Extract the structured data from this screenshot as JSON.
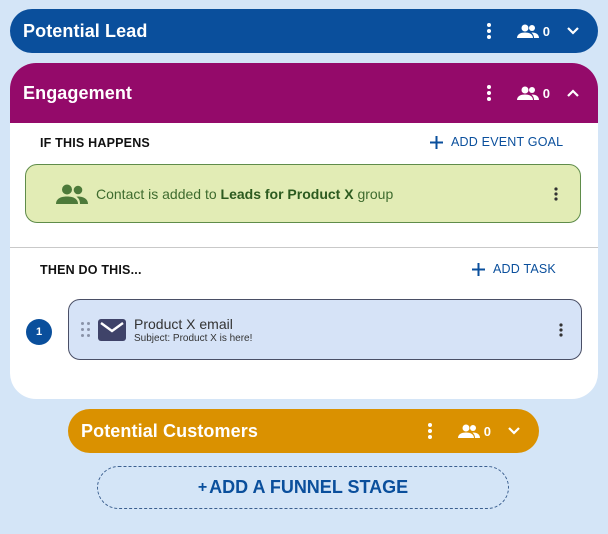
{
  "colors": {
    "potential_lead": "#0a4f9c",
    "engagement": "#940a6a",
    "potential_customers": "#da9100",
    "event_card_bg": "#e2ecb5",
    "task_card_bg": "#d6e3f7",
    "page_bg": "#d4e5f7"
  },
  "stages": [
    {
      "title": "Potential Lead",
      "count": "0",
      "icons": [
        "more-vert-icon",
        "people-icon",
        "chevron-down-icon"
      ]
    },
    {
      "title": "Engagement",
      "count": "0",
      "icons": [
        "more-vert-icon",
        "people-icon",
        "chevron-up-icon"
      ]
    },
    {
      "title": "Potential Customers",
      "count": "0",
      "icons": [
        "more-vert-icon",
        "people-icon",
        "chevron-down-icon"
      ]
    }
  ],
  "engagement": {
    "if_label": "IF THIS HAPPENS",
    "add_event_goal": "ADD EVENT GOAL",
    "event": {
      "icon": "group-icon",
      "prefix": "Contact is added to ",
      "group_name": "Leads for Product X",
      "suffix": " group"
    },
    "then_label": "THEN DO THIS...",
    "add_task": "ADD TASK",
    "task": {
      "number": "1",
      "icon": "email-icon",
      "title": "Product X email",
      "subject": "Subject: Product X is here!"
    }
  },
  "add_stage": {
    "plus": "+",
    "label": "ADD A FUNNEL STAGE"
  }
}
